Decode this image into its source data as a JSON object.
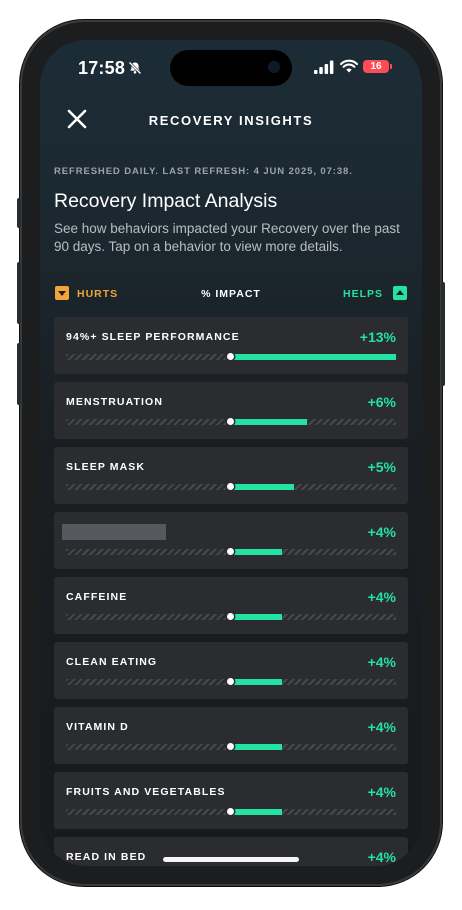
{
  "status_bar": {
    "time": "17:58",
    "battery": "16"
  },
  "header": {
    "title": "RECOVERY INSIGHTS"
  },
  "refresh_text": "REFRESHED DAILY. LAST REFRESH: 4 JUN 2025, 07:38.",
  "heading": "Recovery Impact Analysis",
  "subtitle": "See how behaviors impacted your Recovery over the past 90 days. Tap on a behavior to view more details.",
  "legend": {
    "hurts": "HURTS",
    "impact": "% IMPACT",
    "helps": "HELPS"
  },
  "colors": {
    "helps": "#22e3a0",
    "hurts": "#f2a33a",
    "card": "#2a2c30"
  },
  "behaviors": [
    {
      "label": "94%+ SLEEP PERFORMANCE",
      "impact": "+13%",
      "value": 13
    },
    {
      "label": "MENSTRUATION",
      "impact": "+6%",
      "value": 6
    },
    {
      "label": "SLEEP MASK",
      "impact": "+5%",
      "value": 5
    },
    {
      "label": "",
      "impact": "+4%",
      "value": 4,
      "redacted": true
    },
    {
      "label": "CAFFEINE",
      "impact": "+4%",
      "value": 4
    },
    {
      "label": "CLEAN EATING",
      "impact": "+4%",
      "value": 4
    },
    {
      "label": "VITAMIN D",
      "impact": "+4%",
      "value": 4
    },
    {
      "label": "FRUITS AND VEGETABLES",
      "impact": "+4%",
      "value": 4
    },
    {
      "label": "READ IN BED",
      "impact": "+4%",
      "value": 4
    }
  ]
}
